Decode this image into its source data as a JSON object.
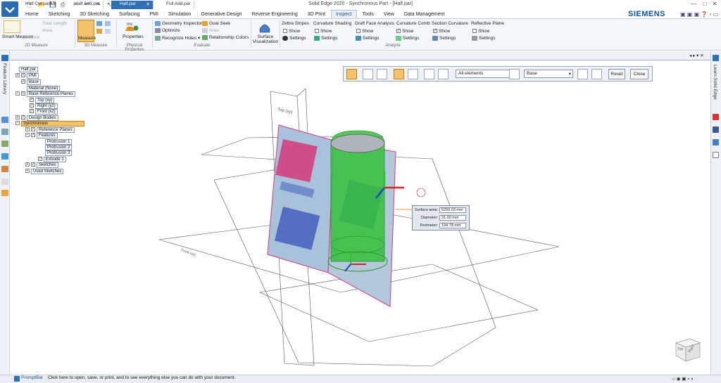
{
  "window": {
    "title": "Solid Edge 2020 - Synchronous Part - [Half.par]",
    "brand": "SIEMENS",
    "controls": [
      "—",
      "□",
      "✕"
    ]
  },
  "ribbon_tabs": [
    "Home",
    "Sketching",
    "3D Sketching",
    "Surfacing",
    "PMI",
    "Simulation",
    "Generative Design",
    "Reverse Engineering",
    "3D Print",
    "Inspect",
    "Tools",
    "View",
    "Data Management"
  ],
  "active_tab": "Inspect",
  "ribbon": {
    "measure2d": {
      "smart_measure": "Smart Measure",
      "distance": "Distance",
      "total_length": "Total Length",
      "area": "Area",
      "group": "2D Measure"
    },
    "measure3d": {
      "measure": "Measure",
      "group": "3D Measure"
    },
    "physical": {
      "properties": "Properties",
      "group": "Physical Properties"
    },
    "evaluate": {
      "geometry_inspector": "Geometry Inspector",
      "optimize": "Optimize",
      "recognize_holes": "Recognize Holes",
      "goal_seek": "Goal Seek",
      "area": "Area",
      "relationship_colors": "Relationship Colors",
      "group": "Evaluate"
    },
    "surface_visualization": "Surface Visualization",
    "analyze": {
      "zebra": {
        "title": "Zebra Stripes",
        "show": "Show",
        "settings": "Settings"
      },
      "curvature_shading": {
        "title": "Curvature Shading",
        "show": "Show",
        "settings": "Settings"
      },
      "draft": {
        "title": "Draft Face Analysis",
        "show": "Show",
        "settings": "Settings"
      },
      "curvature_comb": {
        "title": "Curvature Comb",
        "show": "Show",
        "settings": "Settings"
      },
      "section_curvature": {
        "title": "Section Curvature",
        "show": "Show",
        "settings": "Settings"
      },
      "reflective_plane": {
        "title": "Reflective Plane",
        "show": "Show",
        "settings": "Settings"
      },
      "group": "Analyze"
    }
  },
  "side_labels": {
    "left": "Feature Library",
    "right": "Learn Solid Edge"
  },
  "doc_tabs": [
    {
      "label": "Half Cut.par",
      "active": false
    },
    {
      "label": "Half Add.par",
      "active": false
    },
    {
      "label": "Half.par",
      "active": true
    },
    {
      "label": "Full Add.par",
      "active": false
    }
  ],
  "tree": {
    "root": "Half.par",
    "pmi": "PMI",
    "base": "Base",
    "material": "Material (None)",
    "base_ref_planes": "Base Reference Planes",
    "top": "Top (xy)",
    "right": "Right (yz)",
    "front": "Front (xz)",
    "design_bodies": "Design Bodies",
    "synchronous": "Synchronous",
    "reference_planes": "Reference Planes",
    "features": "Features",
    "protrusion1": "Protrusion 1",
    "protrusion2": "Protrusion 2",
    "protrusion3": "Protrusion 3",
    "extrude1": "Extrude 1",
    "sketches": "Sketches",
    "used_sketches": "Used Sketches"
  },
  "command_bar": {
    "filter": "All elements",
    "base": "Base",
    "reset": "Reset",
    "close": "Close"
  },
  "measure": {
    "surface_area_label": "Surface area:",
    "surface_area_value": "5259.03 mm",
    "diameter_label": "Diameter:",
    "diameter_value": "31.00 mm",
    "perimeter_label": "Perimeter:",
    "perimeter_value": "194.78 mm"
  },
  "viewport_labels": {
    "top_plane": "Top (xy)",
    "front_plane": "Front (xz)"
  },
  "view_cube": {
    "top": "Top",
    "right": "Right"
  },
  "status": {
    "prompt_label": "PromptBar",
    "prompt_text": "Click here to open, save, or print, and to see everything else you can do with your document."
  },
  "colors": {
    "accent": "#2f6fb3",
    "active_tool": "#f3c26b",
    "model_green": "#35c13a",
    "label_pink": "#d63a7a"
  }
}
